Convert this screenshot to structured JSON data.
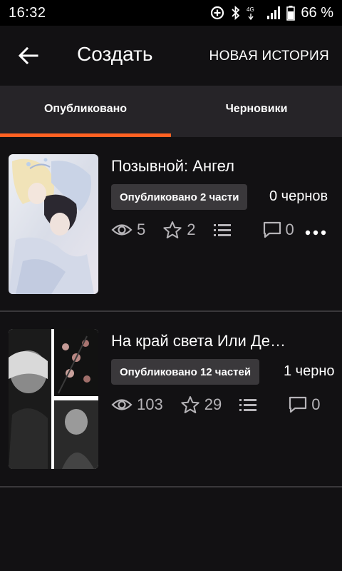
{
  "status_bar": {
    "time": "16:32",
    "battery": "66 %"
  },
  "app_bar": {
    "title": "Создать",
    "new_story": "НОВАЯ ИСТОРИЯ"
  },
  "tabs": [
    {
      "label": "Опубликовано",
      "active": true
    },
    {
      "label": "Черновики",
      "active": false
    }
  ],
  "colors": {
    "accent": "#ff6122",
    "background": "#121113",
    "tab_bar": "#262428",
    "badge": "#3a383b",
    "stat_text": "#b6b4b8"
  },
  "stories": [
    {
      "title": "Позывной: Ангел",
      "published": "Опубликовано 2 части",
      "drafts": "0 чернов",
      "views": "5",
      "votes": "2",
      "comments": "0"
    },
    {
      "title": "На край света Или Де…",
      "published": "Опубликовано 12 частей",
      "drafts": "1 черно",
      "views": "103",
      "votes": "29",
      "comments": "0"
    }
  ],
  "icons": [
    "back-arrow-icon",
    "eye-icon",
    "star-icon",
    "list-icon",
    "comment-icon",
    "more-dots-icon"
  ]
}
